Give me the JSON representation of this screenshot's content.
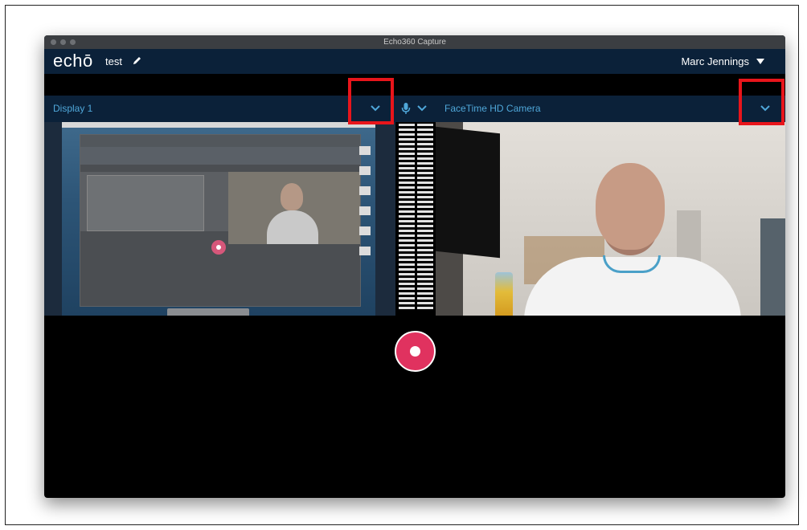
{
  "window": {
    "title": "Echo360 Capture"
  },
  "appbar": {
    "logo": "echō",
    "capture_name": "test",
    "user_name": "Marc Jennings"
  },
  "panels": {
    "display": {
      "label": "Display 1"
    },
    "camera": {
      "label": "FaceTime HD Camera"
    }
  },
  "icons": {
    "pencil": "pencil-icon",
    "caret": "caret-down-icon",
    "chevron": "chevron-down-icon",
    "mic": "microphone-icon",
    "record": "record-icon"
  },
  "colors": {
    "appbar": "#0b2139",
    "accent": "#4fa7d9",
    "record": "#e0325f",
    "highlight": "#e8151b"
  }
}
